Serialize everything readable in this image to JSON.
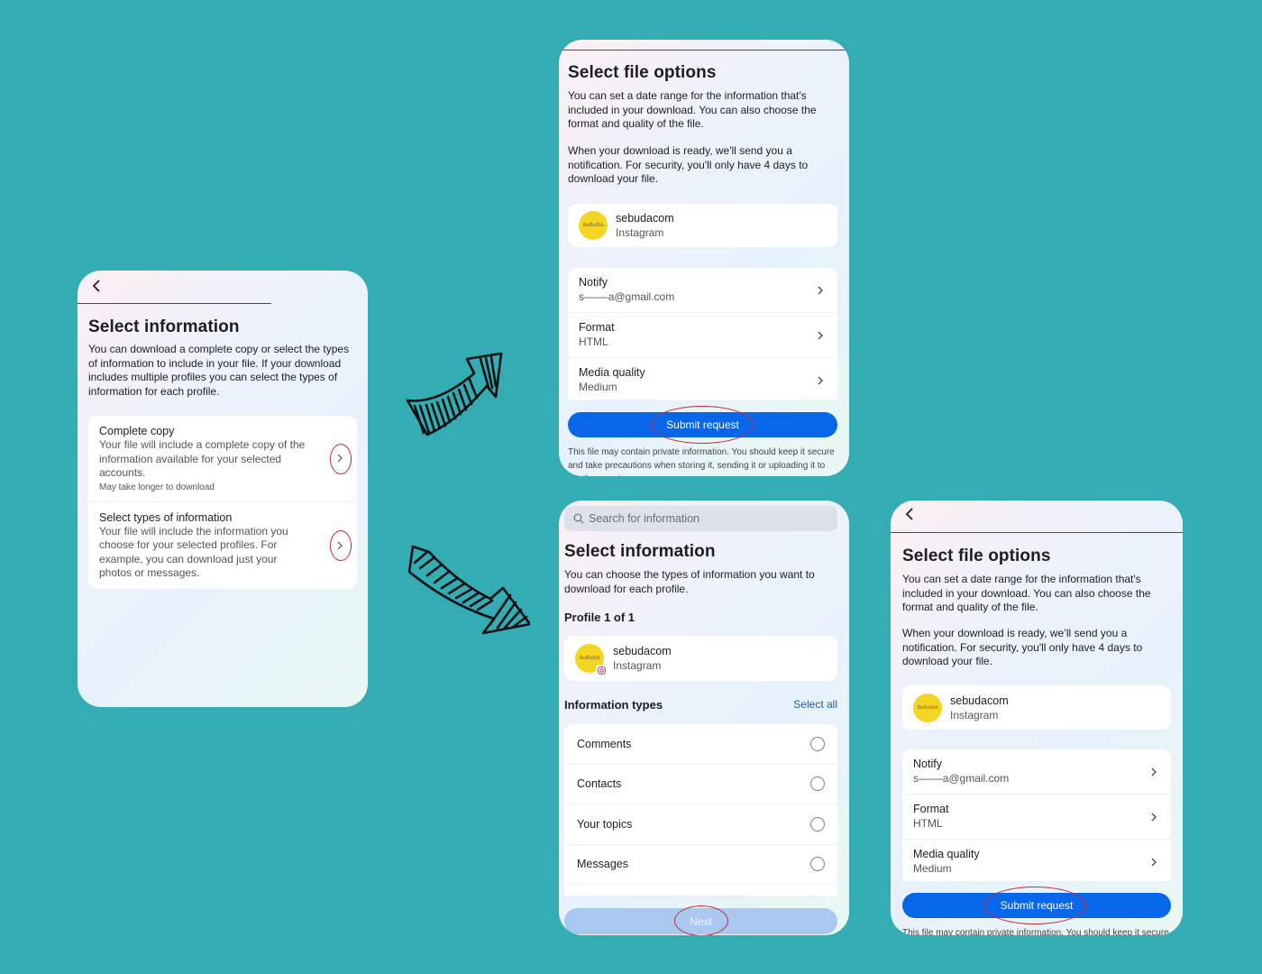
{
  "colors": {
    "background": "#33acb4",
    "primary_button": "#0866e8",
    "disabled_button": "#a9c8ef",
    "annotation_ring": "#c22b3d",
    "link": "#1d5fa8",
    "avatar": "#f5d424"
  },
  "screen_select_information_start": {
    "back_icon": "chevron-left-icon",
    "title": "Select information",
    "description": "You can download a complete copy or select the types of information to include in your file. If your download includes multiple profiles you can select the types of information for each profile.",
    "options": [
      {
        "title": "Complete copy",
        "description": "Your file will include a complete copy of the information available for your selected accounts.",
        "note": "May take longer to download",
        "icon": "chevron-right-icon"
      },
      {
        "title": "Select types of information",
        "description": "Your file will include the information you choose for your selected profiles. For example, you can download just your photos or messages.",
        "icon": "chevron-right-icon"
      }
    ]
  },
  "screen_file_options_top": {
    "title": "Select file options",
    "description_1": "You can set a date range for the information that's included in your download. You can also choose the format and quality of the file.",
    "description_2": "When your download is ready, we'll send you a notification. For security, you'll only have 4 days to download your file.",
    "profile": {
      "avatar_text": "SeBuDA",
      "name": "sebudacom",
      "platform": "Instagram"
    },
    "settings": [
      {
        "label": "Notify",
        "value": "s––––a@gmail.com"
      },
      {
        "label": "Format",
        "value": "HTML"
      },
      {
        "label": "Media quality",
        "value": "Medium"
      }
    ],
    "submit_label": "Submit request",
    "footnote": "This file may contain private information. You should keep it secure and take precautions when storing it, sending it or uploading it to another service."
  },
  "screen_select_information_types": {
    "search_placeholder": "Search for information",
    "title": "Select information",
    "description": "You can choose the types of information you want to download for each profile.",
    "profile_heading": "Profile 1 of 1",
    "profile": {
      "avatar_text": "SeBuDA",
      "name": "sebudacom",
      "platform": "Instagram"
    },
    "types_heading": "Information types",
    "select_all_label": "Select all",
    "types": [
      {
        "label": "Comments",
        "checked": false
      },
      {
        "label": "Contacts",
        "checked": false
      },
      {
        "label": "Your topics",
        "checked": false
      },
      {
        "label": "Messages",
        "checked": false
      }
    ],
    "next_label": "Next"
  },
  "screen_file_options_bottom": {
    "back_icon": "chevron-left-icon",
    "title": "Select file options",
    "description_1": "You can set a date range for the information that's included in your download. You can also choose the format and quality of the file.",
    "description_2": "When your download is ready, we’ll send you a notification. For security, you'll only have 4 days to download your file.",
    "profile": {
      "avatar_text": "SeBuDA",
      "name": "sebudacom",
      "platform": "Instagram"
    },
    "settings": [
      {
        "label": "Notify",
        "value": "s––––a@gmail.com"
      },
      {
        "label": "Format",
        "value": "HTML"
      },
      {
        "label": "Media quality",
        "value": "Medium"
      }
    ],
    "submit_label": "Submit request",
    "footnote": "This file may contain private information. You should keep it secure and take precautions when storing it."
  },
  "arrows": [
    {
      "icon": "hand-drawn-arrow-up-right-icon"
    },
    {
      "icon": "hand-drawn-arrow-down-right-icon"
    }
  ]
}
